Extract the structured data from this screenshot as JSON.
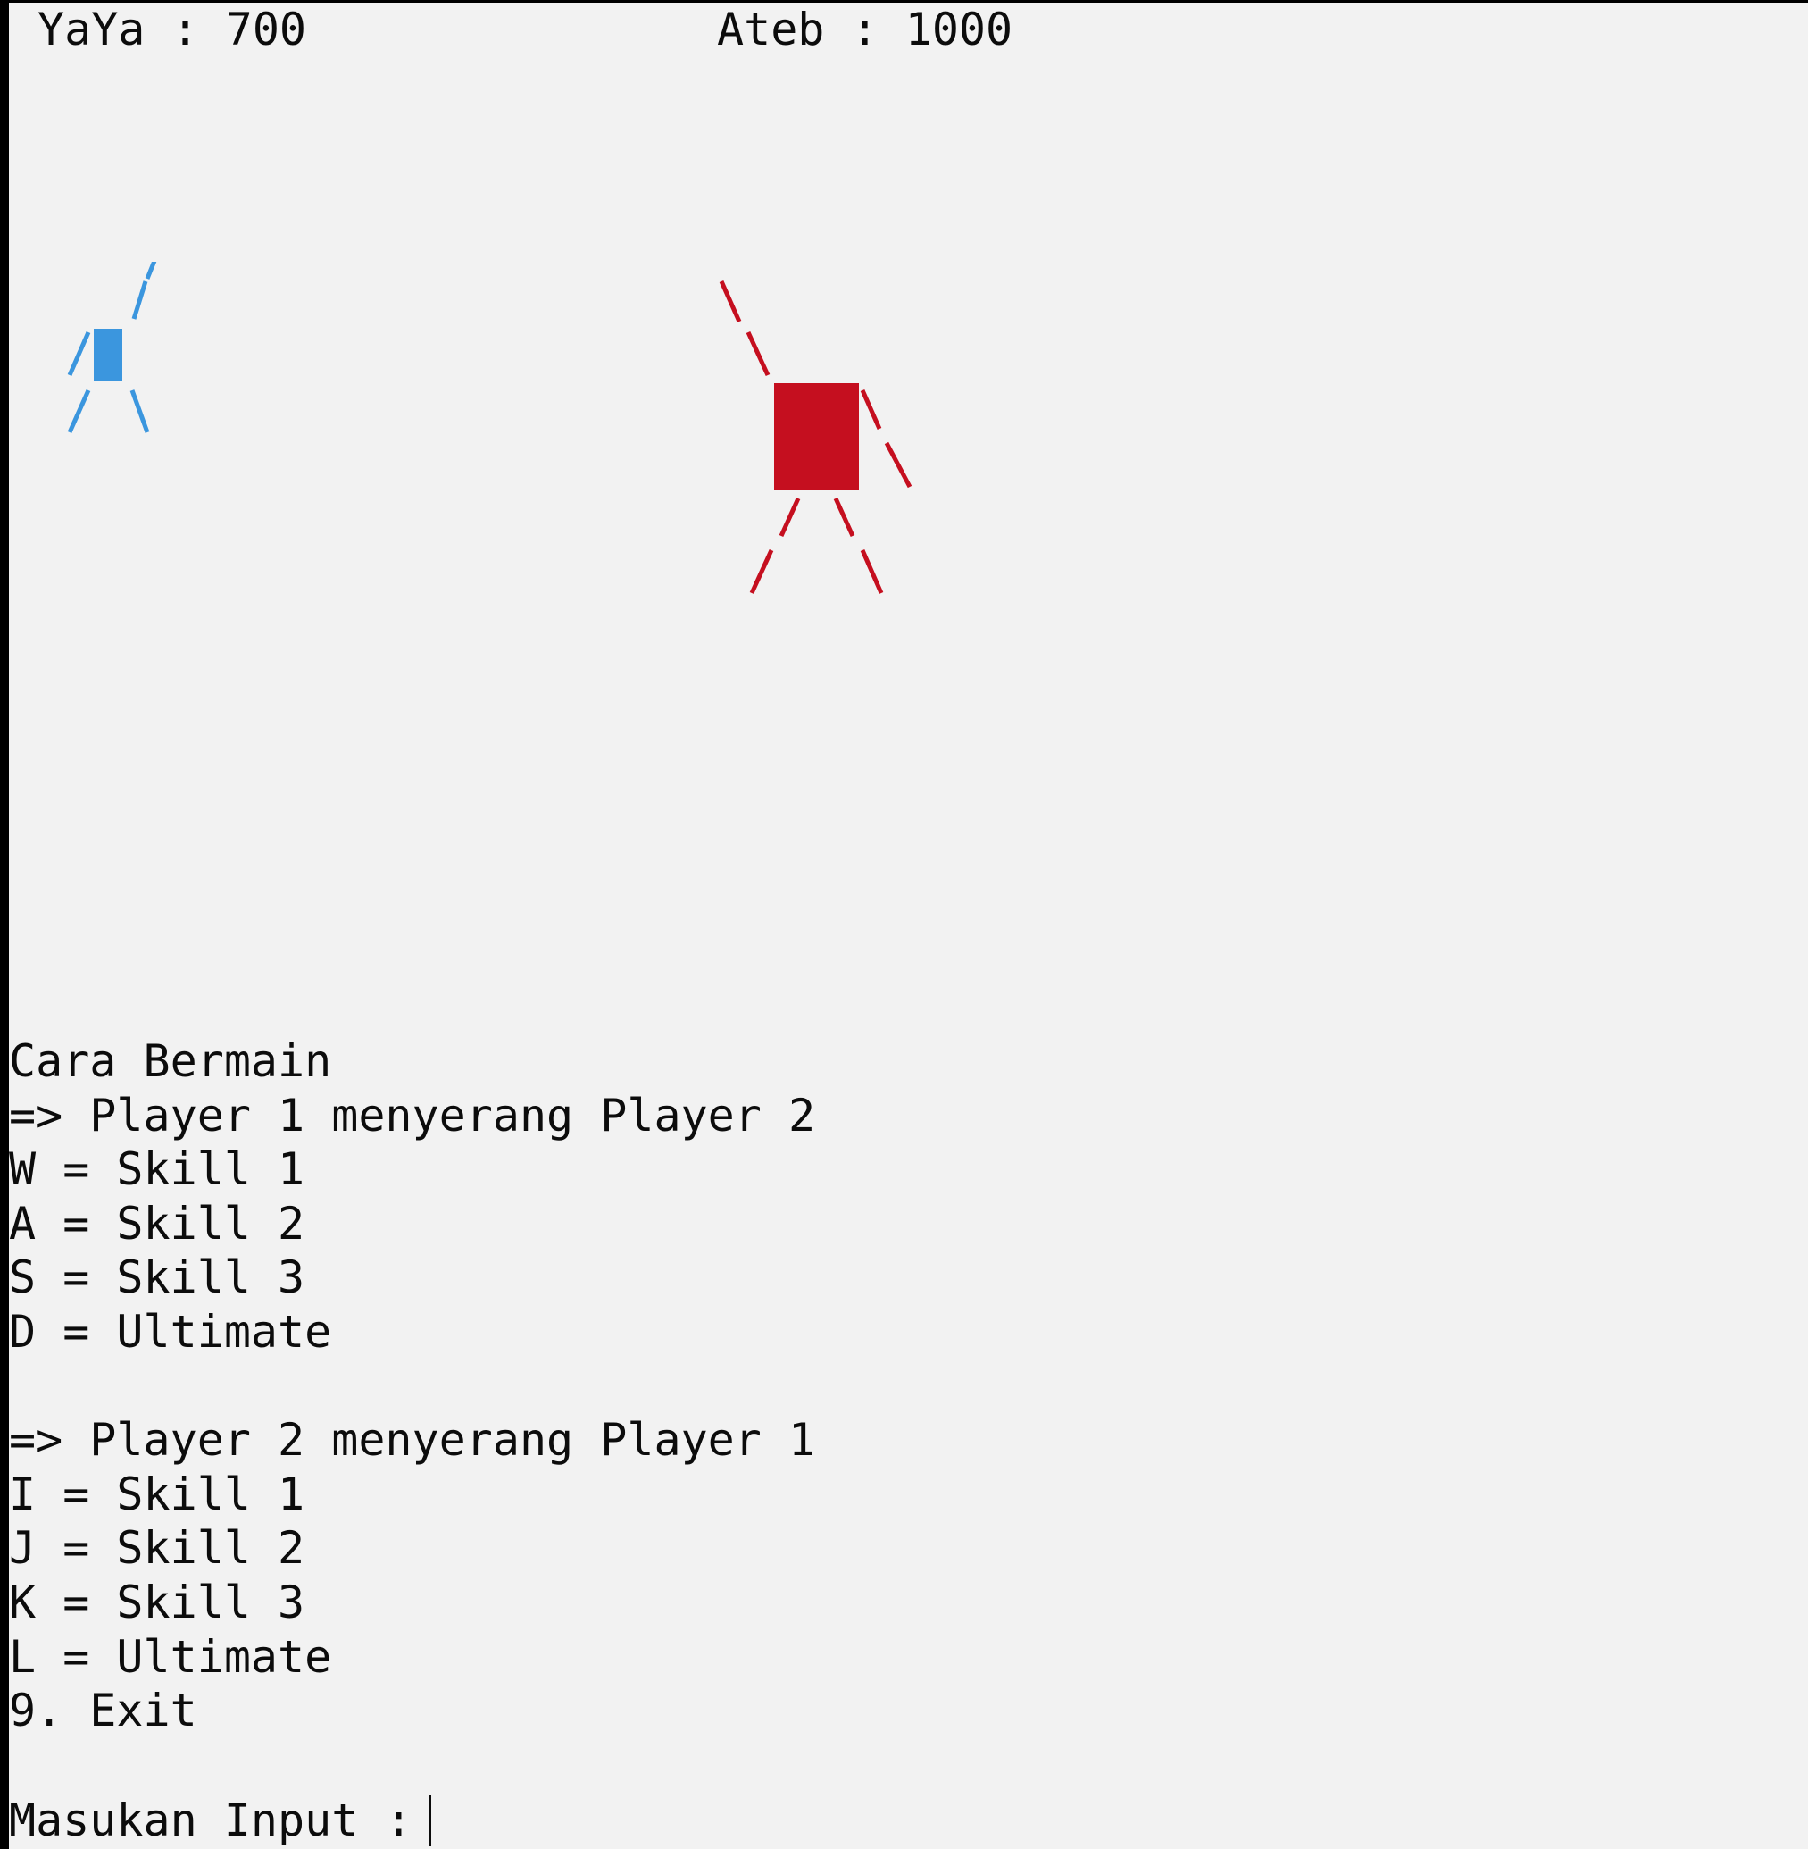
{
  "scoreboard": {
    "player1": "YaYa : 700",
    "player2": "Ateb : 1000"
  },
  "characters": {
    "player1_color": "#3b96de",
    "player2_color": "#c50f1f"
  },
  "instructions": {
    "title": "Cara Bermain",
    "p1_header": "=> Player 1 menyerang Player 2",
    "p1_keys": [
      "W = Skill 1",
      "A = Skill 2",
      "S = Skill 3",
      "D = Ultimate"
    ],
    "p2_header": "=> Player 2 menyerang Player 1",
    "p2_keys": [
      "I = Skill 1",
      "J = Skill 2",
      "K = Skill 3",
      "L = Ultimate"
    ],
    "exit": "9. Exit"
  },
  "prompt": {
    "label": "Masukan Input :"
  }
}
